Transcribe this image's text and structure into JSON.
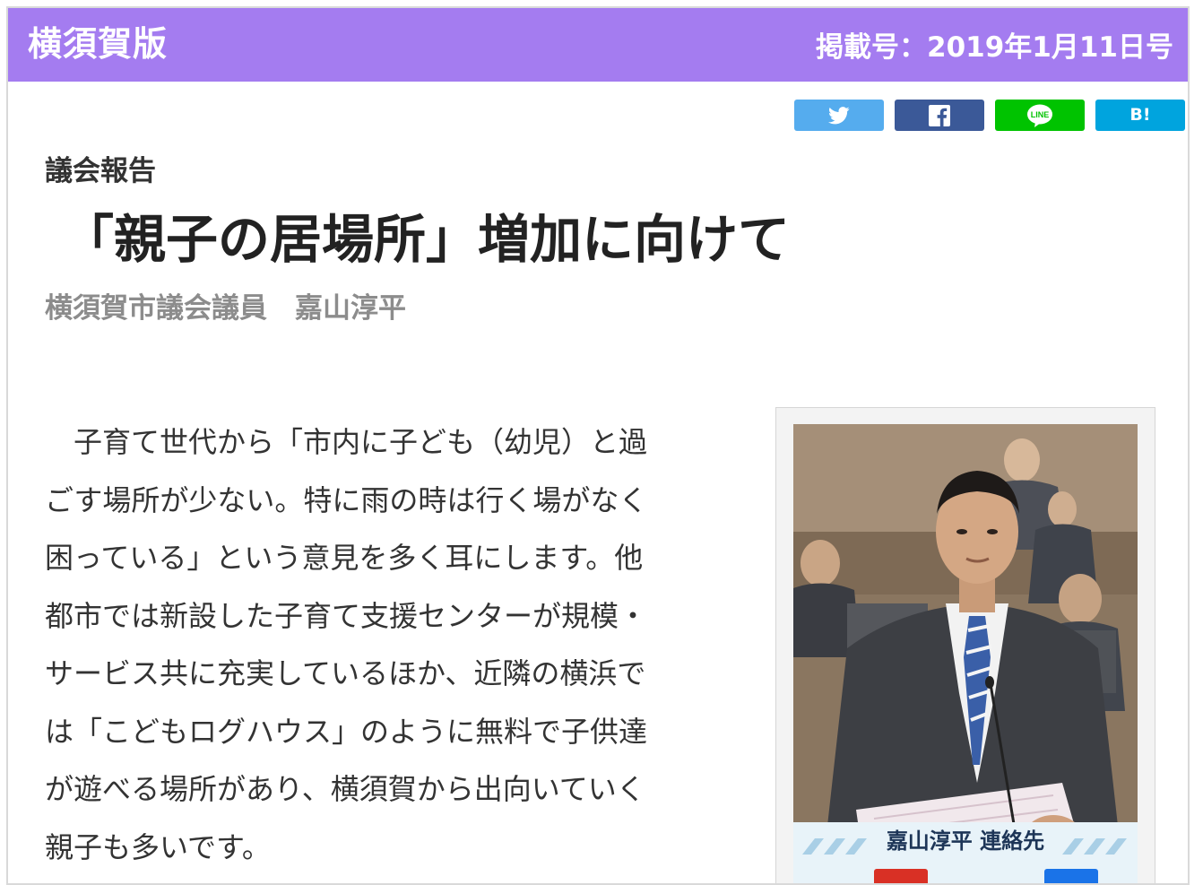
{
  "header": {
    "edition": "横須賀版",
    "issue_date": "掲載号：2019年1月11日号",
    "accent_color": "#a47cf0"
  },
  "share": {
    "twitter_icon": "twitter-icon",
    "facebook_icon": "facebook-icon",
    "line_icon": "line-icon",
    "line_label": "LINE",
    "hatena_label": "B!",
    "colors": {
      "twitter": "#55acee",
      "facebook": "#3b5998",
      "line": "#00c300",
      "hatena": "#00a4de"
    }
  },
  "article": {
    "category": "議会報告",
    "title": "「親子の居場所」増加に向けて",
    "byline": "横須賀市議会議員　嘉山淳平",
    "body_lines": [
      "子育て世代から「市内に子ども（幼児）と過",
      "ごす場所が少ない。特に雨の時は行く場がなく",
      "困っている」という意見を多く耳にします。他",
      "都市では新設した子育て支援センターが規模・",
      "サービス共に充実しているほか、近隣の横浜で",
      "は「こどもログハウス」のように無料で子供達",
      "が遊べる場所があり、横須賀から出向いていく",
      "親子も多いです。"
    ]
  },
  "photo": {
    "caption": "嘉山淳平 連絡先"
  }
}
